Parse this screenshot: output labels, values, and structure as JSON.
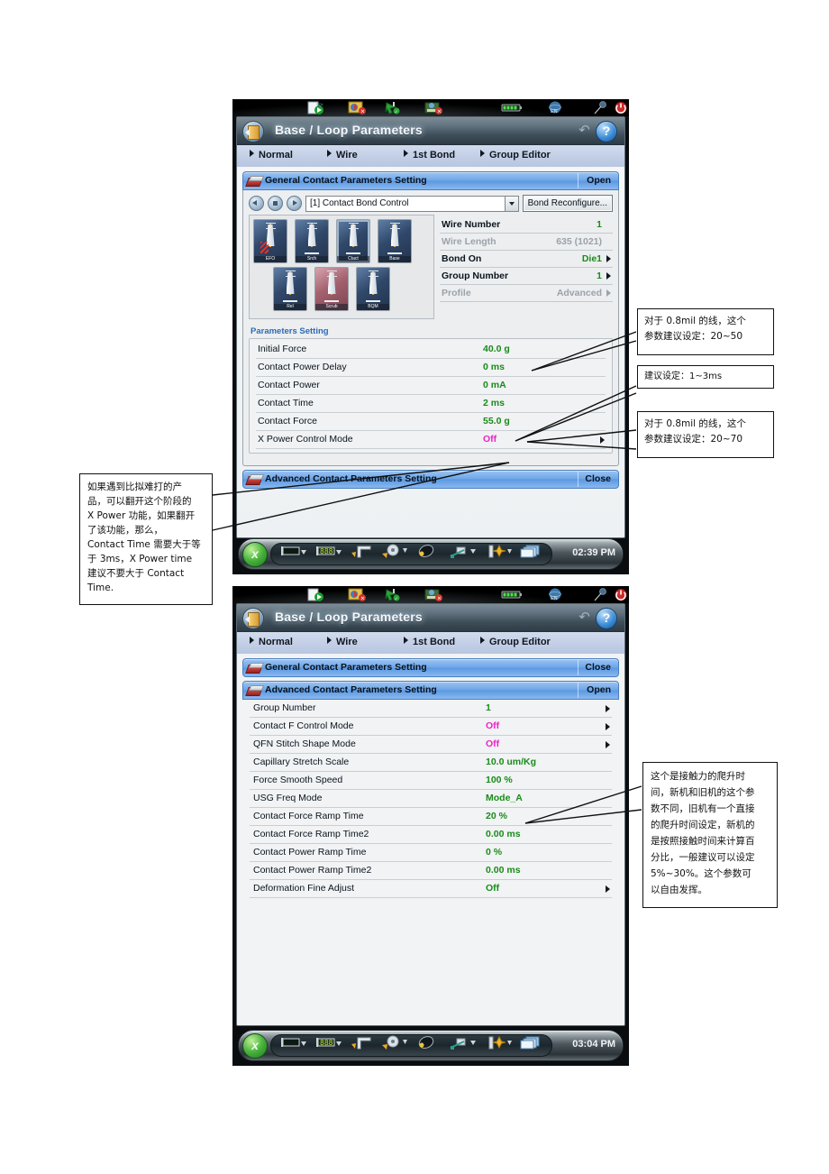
{
  "device1": {
    "statusbar": {
      "icons": [
        "program-run-icon",
        "machine-error-icon",
        "pointer-ok-icon",
        "map-error-icon",
        "battery-icon",
        "lang-en-icon",
        "lamp-icon",
        "power-icon"
      ],
      "lang": "EN"
    },
    "titlebar": {
      "title": "Base / Loop Parameters",
      "back_icon": "back-door-icon",
      "undo_icon": "undo-icon",
      "help_label": "?"
    },
    "tabs": [
      {
        "label": "Normal"
      },
      {
        "label": "Wire"
      },
      {
        "label": "1st Bond"
      },
      {
        "label": "Group Editor"
      }
    ],
    "general_section": {
      "title": "General Contact Parameters Setting",
      "state": "Open"
    },
    "nav": {
      "prev_icon": "arrow-left-icon",
      "stop_icon": "square-stop-icon",
      "next_icon": "arrow-right-icon",
      "combo_value": "[1] Contact Bond Control",
      "reconfigure_label": "Bond Reconfigure..."
    },
    "bond_icons": [
      {
        "caption": "EFO",
        "selected": false,
        "pink": false
      },
      {
        "caption": "Srch",
        "selected": false,
        "pink": false
      },
      {
        "caption": "Ctact",
        "selected": true,
        "pink": false
      },
      {
        "caption": "Base",
        "selected": false,
        "pink": false
      },
      {
        "caption": "Rel",
        "selected": false,
        "pink": false
      },
      {
        "caption": "Scrub",
        "selected": false,
        "pink": true
      },
      {
        "caption": "BQM",
        "selected": false,
        "pink": false
      }
    ],
    "info_rows": [
      {
        "key": "Wire Number",
        "value": "1",
        "arrow": false,
        "dim": false
      },
      {
        "key": "Wire Length",
        "value": "635 (1021)",
        "arrow": false,
        "dim": true
      },
      {
        "key": "Bond On",
        "value": "Die1",
        "arrow": true,
        "dim": false
      },
      {
        "key": "Group Number",
        "value": "1",
        "arrow": true,
        "dim": false
      },
      {
        "key": "Profile",
        "value": "Advanced",
        "arrow": true,
        "dim": true
      }
    ],
    "parameters_label": "Parameters Setting",
    "parameters": [
      {
        "key": "Initial Force",
        "value": "40.0  g",
        "off": false,
        "arrow": false
      },
      {
        "key": "Contact Power Delay",
        "value": "0  ms",
        "off": false,
        "arrow": false
      },
      {
        "key": "Contact Power",
        "value": "0  mA",
        "off": false,
        "arrow": false
      },
      {
        "key": "Contact Time",
        "value": "2  ms",
        "off": false,
        "arrow": false
      },
      {
        "key": "Contact Force",
        "value": "55.0  g",
        "off": false,
        "arrow": false
      },
      {
        "key": "X Power Control Mode",
        "value": "Off",
        "off": true,
        "arrow": true
      }
    ],
    "advanced_section": {
      "title": "Advanced Contact Parameters Setting",
      "state": "Close"
    },
    "taskbar": {
      "logo": "x",
      "time": "02:39 PM",
      "tools": [
        "wafer-table-icon",
        "digital-display-icon",
        "bond-head-icon",
        "spool-icon",
        "clamp-icon",
        "cleaning-icon",
        "calibration-icon",
        "windows-icon"
      ]
    }
  },
  "device2": {
    "titlebar": {
      "title": "Base / Loop Parameters",
      "help_label": "?"
    },
    "tabs": [
      {
        "label": "Normal"
      },
      {
        "label": "Wire"
      },
      {
        "label": "1st Bond"
      },
      {
        "label": "Group Editor"
      }
    ],
    "general_section": {
      "title": "General Contact Parameters Setting",
      "state": "Close"
    },
    "advanced_section": {
      "title": "Advanced Contact Parameters Setting",
      "state": "Open"
    },
    "parameters": [
      {
        "key": "Group Number",
        "value": "1",
        "off": false,
        "arrow": true
      },
      {
        "key": "Contact F Control Mode",
        "value": "Off",
        "off": true,
        "arrow": true
      },
      {
        "key": "QFN Stitch Shape Mode",
        "value": "Off",
        "off": true,
        "arrow": true
      },
      {
        "key": "Capillary Stretch Scale",
        "value": "10.0  um/Kg",
        "off": false,
        "arrow": false
      },
      {
        "key": "Force Smooth Speed",
        "value": "100  %",
        "off": false,
        "arrow": false
      },
      {
        "key": "USG Freq Mode",
        "value": "Mode_A",
        "off": false,
        "arrow": false
      },
      {
        "key": "Contact Force Ramp Time",
        "value": "20  %",
        "off": false,
        "arrow": false
      },
      {
        "key": "Contact Force Ramp Time2",
        "value": "0.00  ms",
        "off": false,
        "arrow": false
      },
      {
        "key": "Contact Power Ramp Time",
        "value": "0  %",
        "off": false,
        "arrow": false
      },
      {
        "key": "Contact Power Ramp Time2",
        "value": "0.00  ms",
        "off": false,
        "arrow": false
      },
      {
        "key": "Deformation Fine Adjust",
        "value": "Off",
        "off": false,
        "arrow": true
      }
    ],
    "taskbar": {
      "logo": "x",
      "time": "03:04 PM"
    }
  },
  "annotations": {
    "note_initial_force": "对于 0.8mil 的线，这个\n参数建议设定：20~50",
    "note_contact_time": "建议设定：1~3ms",
    "note_contact_force": "对于 0.8mil 的线，这个\n参数建议设定：20~70",
    "note_x_power": "如果遇到比拟难打的产品，可以翻开这个阶段的 X Power 功能，如果翻开了该功能，那么，Contact Time 需要大于等于 3ms，X Power time 建议不要大于 Contact Time.",
    "note_ramp_time": "这个是接触力的爬升时间，新机和旧机的这个参数不同，旧机有一个直接的爬升时间设定，新机的是按照接触时间来计算百分比，一般建议可以设定 5%~30%。这个参数可以自由发挥。"
  },
  "colors": {
    "value_green": "#1a8b1a",
    "value_magenta": "#ef22c6",
    "header_blue": "#6ea6e8",
    "tab_blue": "#c3cfe6"
  }
}
